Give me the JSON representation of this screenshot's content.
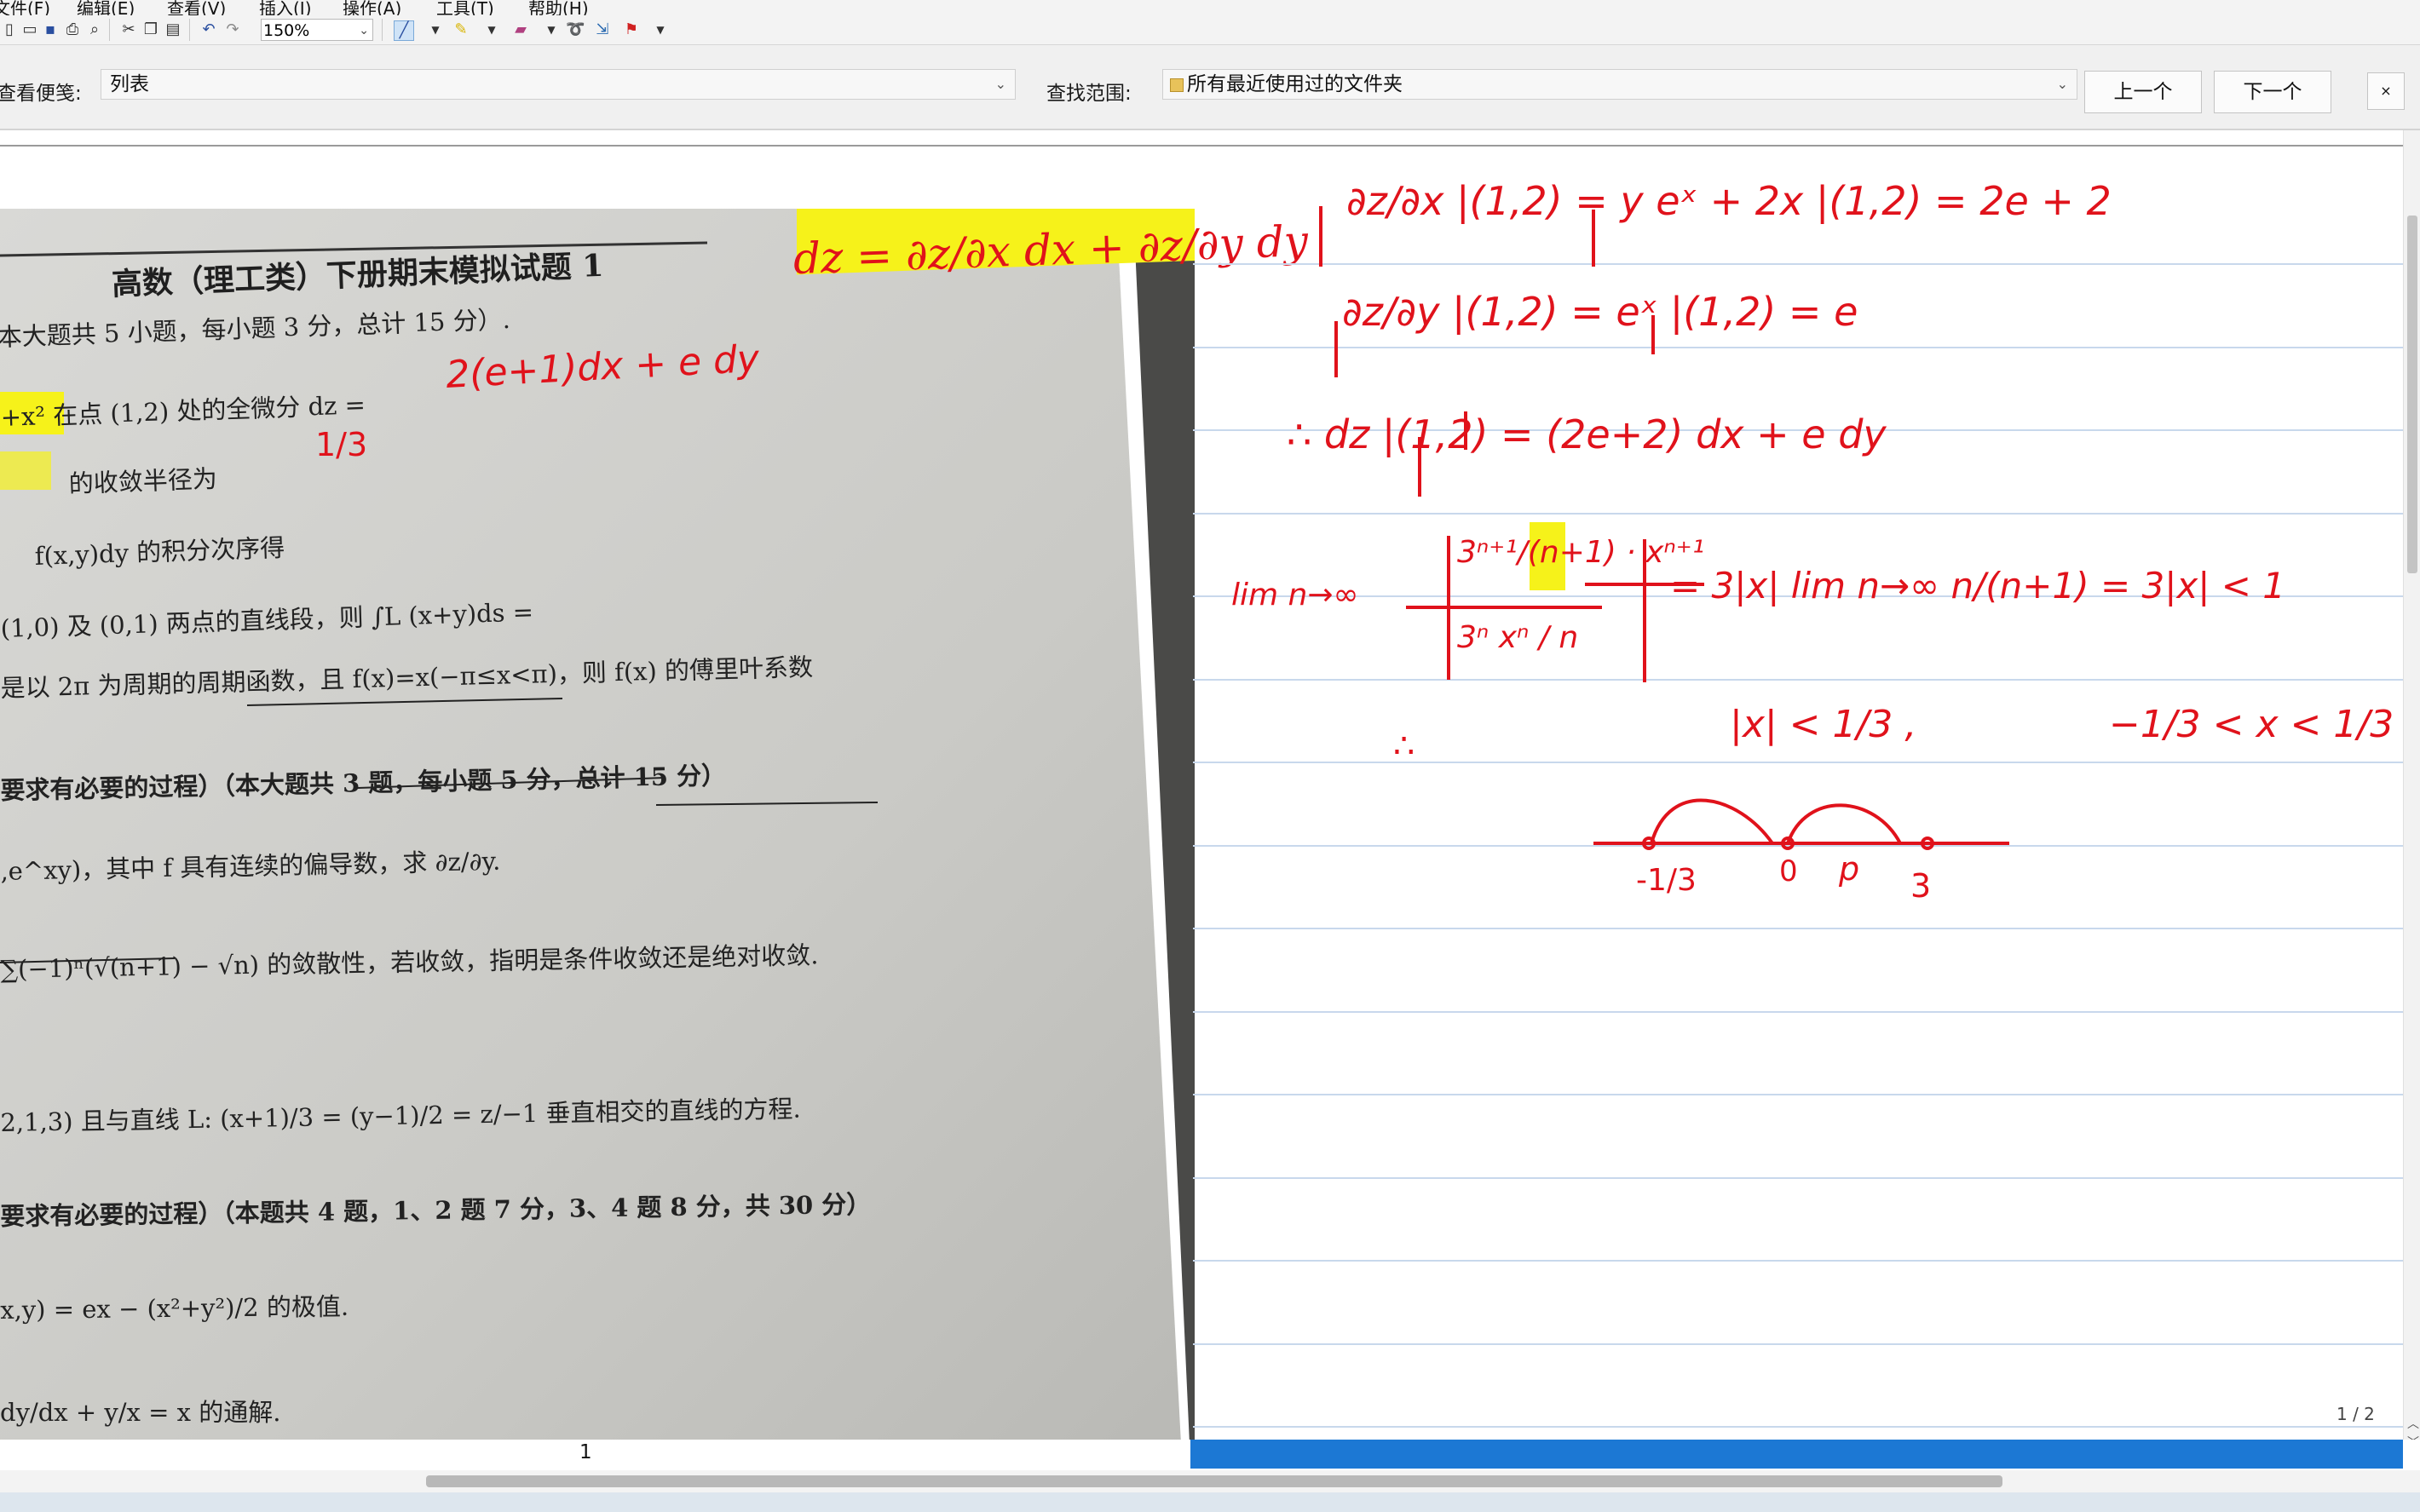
{
  "menu": {
    "items": [
      "文件(F)",
      "编辑(E)",
      "查看(V)",
      "插入(I)",
      "操作(A)",
      "工具(T)",
      "帮助(H)"
    ]
  },
  "toolbar": {
    "zoom_value": "150%",
    "icons": [
      "new-icon",
      "open-icon",
      "save-icon",
      "print-icon",
      "find-icon",
      "cut-icon",
      "copy-icon",
      "paste-icon",
      "undo-icon",
      "redo-icon",
      "pen-icon",
      "highlighter-icon",
      "eraser-icon",
      "lasso-icon",
      "insert-space-icon",
      "flag-icon"
    ]
  },
  "findbar": {
    "view_label": "查看便笺:",
    "view_value": "列表",
    "scope_label": "查找范围:",
    "scope_value": "所有最近使用过的文件夹",
    "prev_button": "上一个",
    "next_button": "下一个",
    "close_glyph": "×"
  },
  "exam": {
    "title": "高数（理工类）下册期末模拟试题 1",
    "section1": "本大题共 5 小题，每小题 3 分，总计 15 分）.",
    "q1": "+x² 在点 (1,2) 处的全微分 dz =",
    "q1_answer": "2(e+1)dx + e dy",
    "q2": "的收敛半径为",
    "q2_answer": "1/3",
    "q3": "f(x,y)dy 的积分次序得",
    "q4": "(1,0) 及 (0,1) 两点的直线段，则 ∫L (x+y)ds =",
    "q5a": "是以 2π 为周期的周期函数，且 f(x)=x(−π≤x<π)，则 f(x) 的傅里叶系数",
    "section2": "要求有必要的过程）（本大题共 3 题，每小题 5 分，总计 15 分）",
    "q6": ",e^xy)，其中 f 具有连续的偏导数，求 ∂z/∂y.",
    "q7": "∑(−1)ⁿ(√(n+1) − √n) 的敛散性，若收敛，指明是条件收敛还是绝对收敛.",
    "q8": "2,1,3) 且与直线 L: (x+1)/3 = (y−1)/2 = z/−1 垂直相交的直线的方程.",
    "section3": "要求有必要的过程）（本题共 4 题，1、2 题 7 分，3、4 题 8 分，共 30 分）",
    "q9": "x,y) = ex − (x²+y²)/2 的极值.",
    "q10": "dy/dx + y/x = x 的通解.",
    "highlight_formula": "dz = ∂z/∂x dx + ∂z/∂y dy"
  },
  "notes": {
    "line1": "∂z/∂x |(1,2) = y eˣ + 2x |(1,2) = 2e + 2",
    "line2": "∂z/∂y |(1,2) = eˣ |(1,2) = e",
    "line3": "∴ dz |(1,2) = (2e+2) dx + e dy",
    "ratio_num": "3ⁿ⁺¹/(n+1) · xⁿ⁺¹",
    "ratio_den": "3ⁿ xⁿ / n",
    "lim": "lim n→∞",
    "ratio_result": "= 3|x| lim n→∞  n/(n+1)  = 3|x| < 1",
    "abs_x": "|x| < 1/3 ,",
    "interval": "−1/3 < x < 1/3",
    "therefore": "∴",
    "axis_labels": [
      "-1/3",
      "0",
      "p",
      "3"
    ]
  },
  "statusbar": {
    "page_number": "1",
    "page_indicator": "1 / 2"
  },
  "colors": {
    "ink_red": "#e0121b",
    "highlight_yellow": "#f6f21a",
    "status_blue": "#1c78d4",
    "paper_gray": "#cfcfcb",
    "rule_blue": "#c8d8ec"
  }
}
